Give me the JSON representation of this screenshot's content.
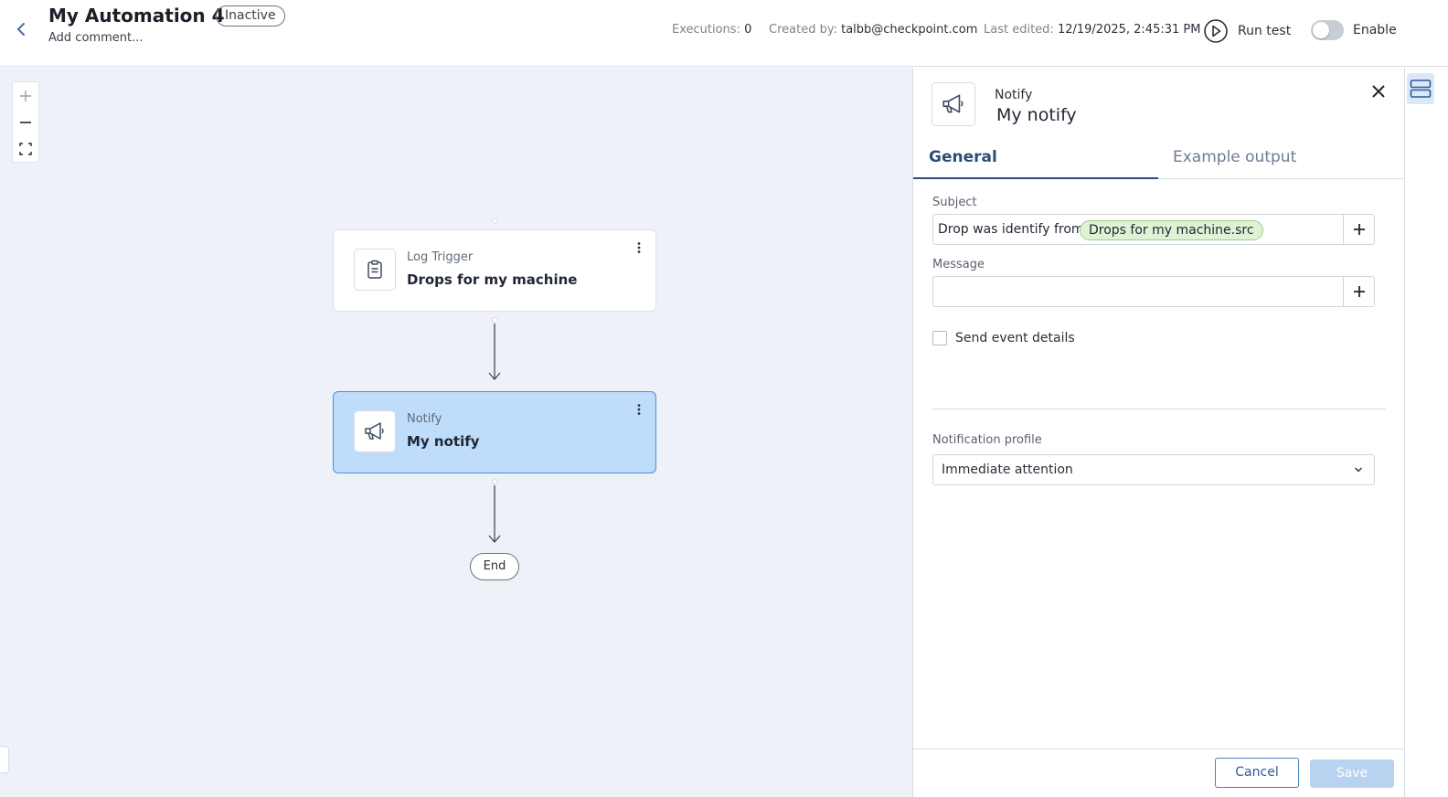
{
  "header": {
    "title": "My Automation 4",
    "status": "Inactive",
    "comment_placeholder": "Add comment...",
    "executions_label": "Executions:",
    "executions_value": "0",
    "created_label": "Created by:",
    "created_value": "talbb@checkpoint.com",
    "edited_label": "Last edited:",
    "edited_value": "12/19/2025, 2:45:31 PM",
    "run_test": "Run test",
    "enable": "Enable"
  },
  "canvas": {
    "nodes": [
      {
        "type": "Log Trigger",
        "name": "Drops for my machine",
        "icon": "clipboard-icon"
      },
      {
        "type": "Notify",
        "name": "My notify",
        "icon": "megaphone-icon",
        "selected": true
      }
    ],
    "end_label": "End"
  },
  "panel": {
    "type": "Notify",
    "name": "My notify",
    "tabs": [
      {
        "label": "General",
        "active": true
      },
      {
        "label": "Example output",
        "active": false
      }
    ],
    "subject_label": "Subject",
    "subject_text": "Drop was identify from",
    "subject_chip": "Drops for my machine.src",
    "message_label": "Message",
    "message_value": "",
    "send_event_details": "Send event details",
    "send_event_checked": false,
    "notification_profile_label": "Notification profile",
    "notification_profile_value": "Immediate attention",
    "cancel": "Cancel",
    "save": "Save"
  },
  "colors": {
    "accent": "#2c4d78",
    "selected_node_bg": "#bfdcfb",
    "canvas_bg": "#eef1f7",
    "chip_bg": "#dff3d4"
  }
}
